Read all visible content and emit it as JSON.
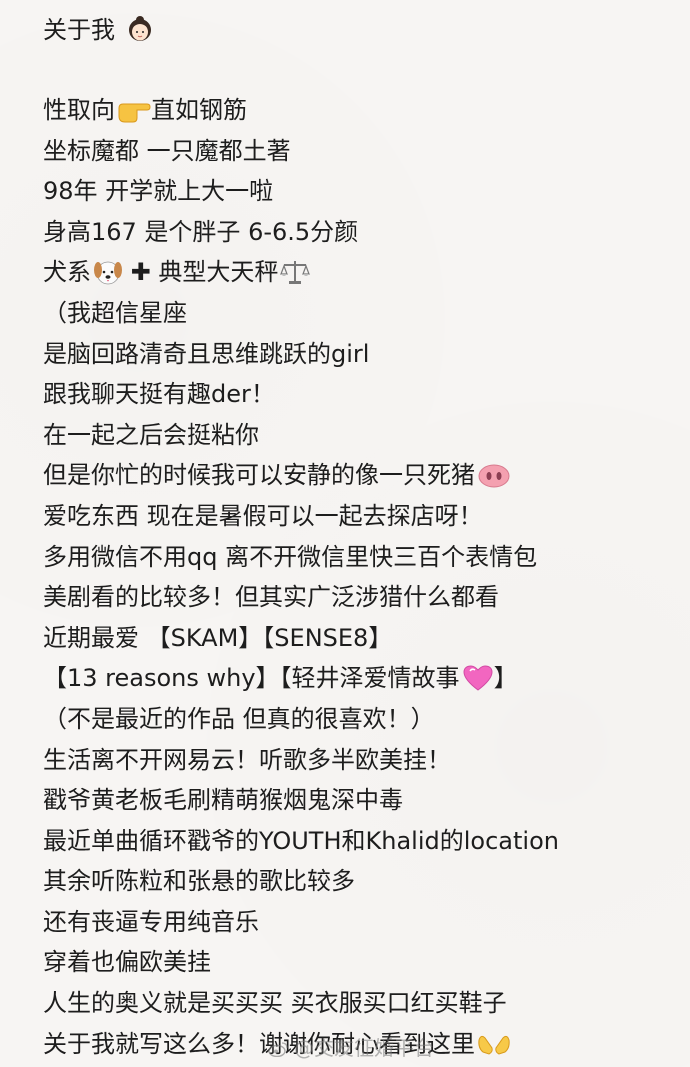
{
  "title": {
    "text": "关于我",
    "emoji_icon": "girl-face-icon"
  },
  "lines": [
    {
      "text": "性取向",
      "emoji_icon": "pointing-right-hand-icon",
      "after": "直如钢筋"
    },
    {
      "text": "坐标魔都 一只魔都土著"
    },
    {
      "text": "98年 开学就上大一啦"
    },
    {
      "text": "身高167 是个胖子 6-6.5分颜"
    },
    {
      "text": "犬系",
      "emoji_icon": "dog-face-icon",
      "plus": "✚",
      "after": "典型大天秤",
      "trail_icon": "scales-icon"
    },
    {
      "text": "（我超信星座"
    },
    {
      "text": "是脑回路清奇且思维跳跃的girl"
    },
    {
      "text": "跟我聊天挺有趣der！"
    },
    {
      "text": "在一起之后会挺粘你"
    },
    {
      "text": "但是你忙的时候我可以安静的像一只死猪",
      "trail_icon": "pig-nose-icon"
    },
    {
      "text": "爱吃东西 现在是暑假可以一起去探店呀！"
    },
    {
      "text": "多用微信不用qq 离不开微信里快三百个表情包"
    },
    {
      "text": "美剧看的比较多！但其实广泛涉猎什么都看"
    },
    {
      "text": "近期最爱 【SKAM】【SENSE8】"
    },
    {
      "text": "【13 reasons why】【轻井泽爱情故事",
      "trail_icon": "pink-heart-icon",
      "after": "】"
    },
    {
      "text": "（不是最近的作品 但真的很喜欢！）"
    },
    {
      "text": "生活离不开网易云！听歌多半欧美挂！"
    },
    {
      "text": "戳爷黄老板毛刷精萌猴烟鬼深中毒"
    },
    {
      "text": "最近单曲循环戳爷的YOUTH和Khalid的location"
    },
    {
      "text": "其余听陈粒和张悬的歌比较多"
    },
    {
      "text": "还有丧逼专用纯音乐"
    },
    {
      "text": "穿着也偏欧美挂"
    },
    {
      "text": "人生的奥义就是买买买 买衣服买口红买鞋子"
    },
    {
      "text": "关于我就写这么多！谢谢你耐心看到这里",
      "trail_icon": "open-hands-icon"
    }
  ],
  "watermark": {
    "text": "@交友征婚平台",
    "icon": "weibo-icon"
  }
}
